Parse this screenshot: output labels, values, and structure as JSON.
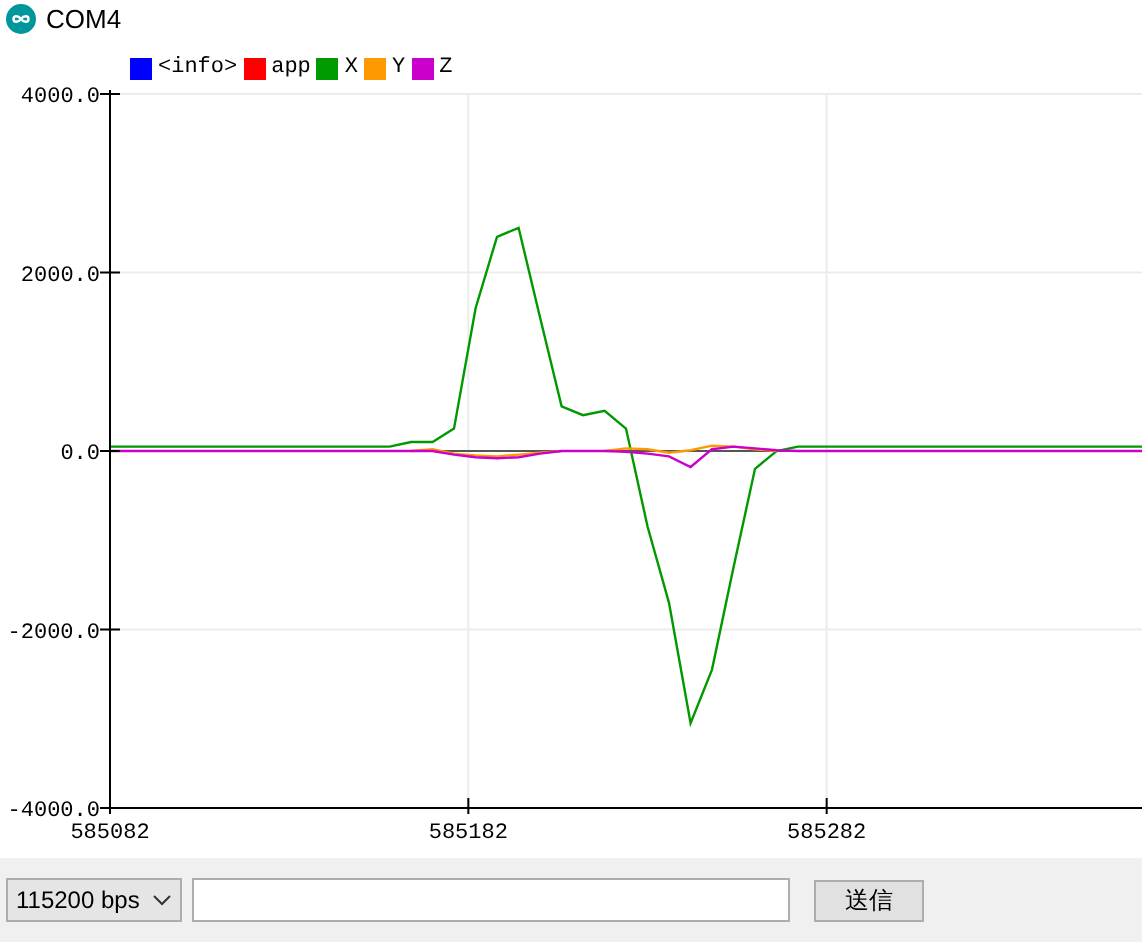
{
  "window": {
    "title": "COM4"
  },
  "plot": {
    "chart_data": {
      "type": "line",
      "x": [
        585082,
        585088,
        585094,
        585100,
        585106,
        585112,
        585118,
        585124,
        585130,
        585136,
        585142,
        585148,
        585154,
        585160,
        585166,
        585172,
        585178,
        585184,
        585190,
        585196,
        585202,
        585208,
        585214,
        585220,
        585226,
        585232,
        585238,
        585244,
        585250,
        585256,
        585262,
        585268,
        585274,
        585280,
        585286,
        585292,
        585298,
        585304,
        585310,
        585316,
        585322,
        585328,
        585334,
        585340,
        585346,
        585352,
        585358,
        585364,
        585370
      ],
      "xlim": [
        585082,
        585370
      ],
      "ylim": [
        -4000,
        4000
      ],
      "grid": true,
      "xticks": [
        585082,
        585182,
        585282
      ],
      "yticks": [
        {
          "value": -4000,
          "label": "-4000.0"
        },
        {
          "value": -2000,
          "label": "-2000.0"
        },
        {
          "value": 0,
          "label": "0.0"
        },
        {
          "value": 2000,
          "label": "2000.0"
        },
        {
          "value": 4000,
          "label": "4000.0"
        }
      ],
      "series": [
        {
          "name": "<info>",
          "color": "#0000ff",
          "values": [
            null,
            null,
            null,
            null,
            null,
            null,
            null,
            null,
            null,
            null,
            null,
            null,
            null,
            null,
            null,
            null,
            null,
            null,
            null,
            null,
            null,
            null,
            null,
            null,
            null,
            null,
            null,
            null,
            null,
            null,
            null,
            null,
            null,
            null,
            null,
            null,
            null,
            null,
            null,
            null,
            null,
            null,
            null,
            null,
            null,
            null,
            null,
            null,
            null
          ]
        },
        {
          "name": "app",
          "color": "#ff0000",
          "values": [
            null,
            null,
            null,
            null,
            null,
            null,
            null,
            null,
            null,
            null,
            null,
            null,
            null,
            null,
            null,
            null,
            null,
            null,
            null,
            null,
            null,
            null,
            null,
            null,
            null,
            null,
            null,
            null,
            null,
            null,
            null,
            null,
            null,
            null,
            null,
            null,
            null,
            null,
            null,
            null,
            null,
            null,
            null,
            null,
            null,
            null,
            null,
            null,
            null
          ]
        },
        {
          "name": "X",
          "color": "#009900",
          "values": [
            50,
            50,
            50,
            50,
            50,
            50,
            50,
            50,
            50,
            50,
            50,
            50,
            50,
            50,
            100,
            100,
            250,
            1600,
            2400,
            2500,
            1500,
            500,
            400,
            450,
            250,
            -850,
            -1700,
            -3050,
            -2450,
            -1300,
            -200,
            0,
            50,
            50,
            50,
            50,
            50,
            50,
            50,
            50,
            50,
            50,
            50,
            50,
            50,
            50,
            50,
            50,
            50
          ]
        },
        {
          "name": "Y",
          "color": "#ff9900",
          "values": [
            null,
            null,
            null,
            null,
            null,
            null,
            null,
            null,
            null,
            null,
            null,
            null,
            null,
            null,
            0,
            20,
            -30,
            -50,
            -60,
            -40,
            -20,
            0,
            null,
            0,
            30,
            20,
            -20,
            10,
            60,
            50,
            20,
            0,
            null,
            null,
            null,
            null,
            null,
            null,
            null,
            null,
            null,
            null,
            null,
            null,
            null,
            null,
            null,
            null,
            null
          ]
        },
        {
          "name": "Z",
          "color": "#cc00cc",
          "values": [
            0,
            0,
            0,
            0,
            0,
            0,
            0,
            0,
            0,
            0,
            0,
            0,
            0,
            0,
            0,
            0,
            -40,
            -70,
            -80,
            -70,
            -30,
            0,
            0,
            0,
            -10,
            -30,
            -60,
            -180,
            20,
            50,
            30,
            10,
            0,
            0,
            0,
            0,
            0,
            0,
            0,
            0,
            0,
            0,
            0,
            0,
            0,
            0,
            0,
            0,
            0
          ]
        }
      ]
    }
  },
  "controls": {
    "baud_rate": "115200 bps",
    "send_button": "送信"
  }
}
